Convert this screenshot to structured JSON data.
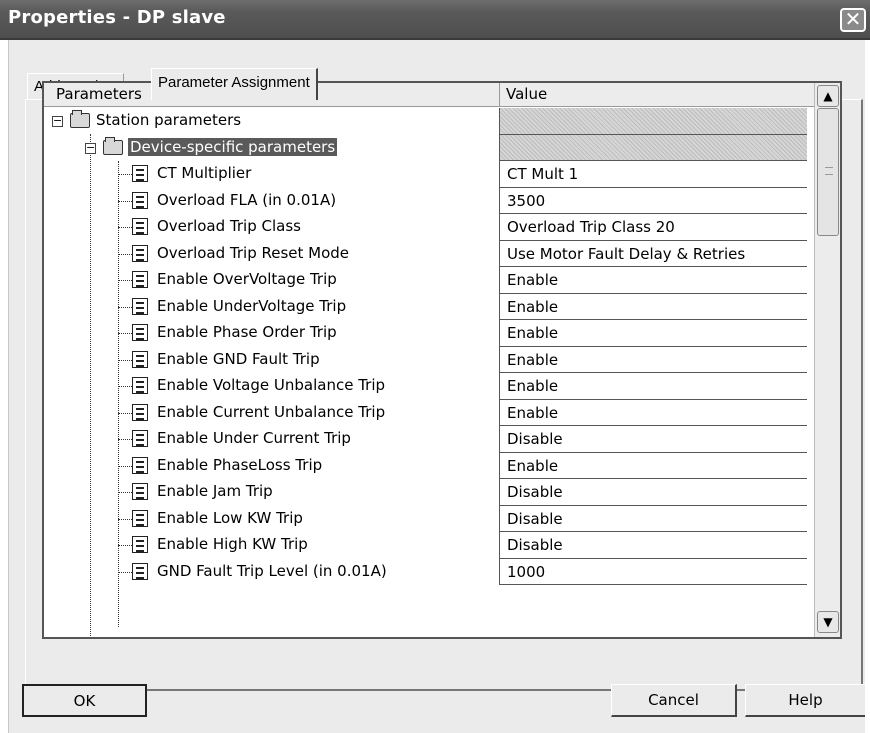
{
  "window": {
    "title": "Properties - DP slave",
    "close_glyph": "✕"
  },
  "tabs": [
    {
      "label": "Address / ID",
      "active": false
    },
    {
      "label": "Parameter Assignment",
      "active": true
    }
  ],
  "grid": {
    "columns": [
      "Parameters",
      "Value"
    ],
    "root": {
      "label": "Station parameters",
      "value": "",
      "expander": "−"
    },
    "group": {
      "label": "Device-specific parameters",
      "value": "",
      "expander": "−"
    },
    "rows": [
      {
        "label": "CT Multiplier",
        "value": "CT Mult 1"
      },
      {
        "label": "Overload FLA (in 0.01A)",
        "value": "3500"
      },
      {
        "label": "Overload Trip Class",
        "value": "Overload Trip Class 20"
      },
      {
        "label": "Overload Trip Reset Mode",
        "value": "Use Motor Fault Delay & Retries"
      },
      {
        "label": "Enable OverVoltage Trip",
        "value": "Enable"
      },
      {
        "label": "Enable UnderVoltage Trip",
        "value": "Enable"
      },
      {
        "label": "Enable Phase Order Trip",
        "value": "Enable"
      },
      {
        "label": "Enable GND Fault Trip",
        "value": "Enable"
      },
      {
        "label": "Enable Voltage Unbalance Trip",
        "value": "Enable"
      },
      {
        "label": "Enable Current Unbalance Trip",
        "value": "Enable"
      },
      {
        "label": "Enable Under Current Trip",
        "value": "Disable"
      },
      {
        "label": "Enable PhaseLoss Trip",
        "value": "Enable"
      },
      {
        "label": "Enable Jam Trip",
        "value": "Disable"
      },
      {
        "label": "Enable Low KW Trip",
        "value": "Disable"
      },
      {
        "label": "Enable High KW Trip",
        "value": "Disable"
      },
      {
        "label": "GND Fault Trip Level (in 0.01A)",
        "value": "1000"
      }
    ],
    "scroll_up": "▲",
    "scroll_down": "▼"
  },
  "buttons": {
    "ok": "OK",
    "cancel": "Cancel",
    "help": "Help"
  },
  "icons": {
    "folder": "folder-icon",
    "parameter": "parameter-icon",
    "close": "close-icon"
  }
}
